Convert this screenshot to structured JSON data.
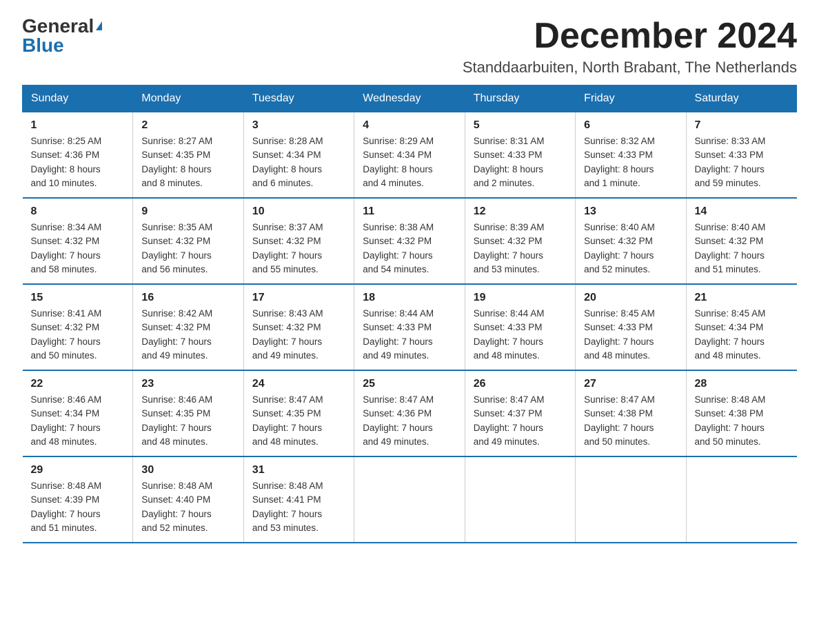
{
  "header": {
    "logo_general": "General",
    "logo_triangle": "▶",
    "logo_blue": "Blue",
    "month_title": "December 2024",
    "subtitle": "Standdaarbuiten, North Brabant, The Netherlands"
  },
  "weekdays": [
    "Sunday",
    "Monday",
    "Tuesday",
    "Wednesday",
    "Thursday",
    "Friday",
    "Saturday"
  ],
  "weeks": [
    [
      {
        "day": "1",
        "sunrise": "8:25 AM",
        "sunset": "4:36 PM",
        "daylight": "8 hours and 10 minutes."
      },
      {
        "day": "2",
        "sunrise": "8:27 AM",
        "sunset": "4:35 PM",
        "daylight": "8 hours and 8 minutes."
      },
      {
        "day": "3",
        "sunrise": "8:28 AM",
        "sunset": "4:34 PM",
        "daylight": "8 hours and 6 minutes."
      },
      {
        "day": "4",
        "sunrise": "8:29 AM",
        "sunset": "4:34 PM",
        "daylight": "8 hours and 4 minutes."
      },
      {
        "day": "5",
        "sunrise": "8:31 AM",
        "sunset": "4:33 PM",
        "daylight": "8 hours and 2 minutes."
      },
      {
        "day": "6",
        "sunrise": "8:32 AM",
        "sunset": "4:33 PM",
        "daylight": "8 hours and 1 minute."
      },
      {
        "day": "7",
        "sunrise": "8:33 AM",
        "sunset": "4:33 PM",
        "daylight": "7 hours and 59 minutes."
      }
    ],
    [
      {
        "day": "8",
        "sunrise": "8:34 AM",
        "sunset": "4:32 PM",
        "daylight": "7 hours and 58 minutes."
      },
      {
        "day": "9",
        "sunrise": "8:35 AM",
        "sunset": "4:32 PM",
        "daylight": "7 hours and 56 minutes."
      },
      {
        "day": "10",
        "sunrise": "8:37 AM",
        "sunset": "4:32 PM",
        "daylight": "7 hours and 55 minutes."
      },
      {
        "day": "11",
        "sunrise": "8:38 AM",
        "sunset": "4:32 PM",
        "daylight": "7 hours and 54 minutes."
      },
      {
        "day": "12",
        "sunrise": "8:39 AM",
        "sunset": "4:32 PM",
        "daylight": "7 hours and 53 minutes."
      },
      {
        "day": "13",
        "sunrise": "8:40 AM",
        "sunset": "4:32 PM",
        "daylight": "7 hours and 52 minutes."
      },
      {
        "day": "14",
        "sunrise": "8:40 AM",
        "sunset": "4:32 PM",
        "daylight": "7 hours and 51 minutes."
      }
    ],
    [
      {
        "day": "15",
        "sunrise": "8:41 AM",
        "sunset": "4:32 PM",
        "daylight": "7 hours and 50 minutes."
      },
      {
        "day": "16",
        "sunrise": "8:42 AM",
        "sunset": "4:32 PM",
        "daylight": "7 hours and 49 minutes."
      },
      {
        "day": "17",
        "sunrise": "8:43 AM",
        "sunset": "4:32 PM",
        "daylight": "7 hours and 49 minutes."
      },
      {
        "day": "18",
        "sunrise": "8:44 AM",
        "sunset": "4:33 PM",
        "daylight": "7 hours and 49 minutes."
      },
      {
        "day": "19",
        "sunrise": "8:44 AM",
        "sunset": "4:33 PM",
        "daylight": "7 hours and 48 minutes."
      },
      {
        "day": "20",
        "sunrise": "8:45 AM",
        "sunset": "4:33 PM",
        "daylight": "7 hours and 48 minutes."
      },
      {
        "day": "21",
        "sunrise": "8:45 AM",
        "sunset": "4:34 PM",
        "daylight": "7 hours and 48 minutes."
      }
    ],
    [
      {
        "day": "22",
        "sunrise": "8:46 AM",
        "sunset": "4:34 PM",
        "daylight": "7 hours and 48 minutes."
      },
      {
        "day": "23",
        "sunrise": "8:46 AM",
        "sunset": "4:35 PM",
        "daylight": "7 hours and 48 minutes."
      },
      {
        "day": "24",
        "sunrise": "8:47 AM",
        "sunset": "4:35 PM",
        "daylight": "7 hours and 48 minutes."
      },
      {
        "day": "25",
        "sunrise": "8:47 AM",
        "sunset": "4:36 PM",
        "daylight": "7 hours and 49 minutes."
      },
      {
        "day": "26",
        "sunrise": "8:47 AM",
        "sunset": "4:37 PM",
        "daylight": "7 hours and 49 minutes."
      },
      {
        "day": "27",
        "sunrise": "8:47 AM",
        "sunset": "4:38 PM",
        "daylight": "7 hours and 50 minutes."
      },
      {
        "day": "28",
        "sunrise": "8:48 AM",
        "sunset": "4:38 PM",
        "daylight": "7 hours and 50 minutes."
      }
    ],
    [
      {
        "day": "29",
        "sunrise": "8:48 AM",
        "sunset": "4:39 PM",
        "daylight": "7 hours and 51 minutes."
      },
      {
        "day": "30",
        "sunrise": "8:48 AM",
        "sunset": "4:40 PM",
        "daylight": "7 hours and 52 minutes."
      },
      {
        "day": "31",
        "sunrise": "8:48 AM",
        "sunset": "4:41 PM",
        "daylight": "7 hours and 53 minutes."
      },
      null,
      null,
      null,
      null
    ]
  ],
  "labels": {
    "sunrise": "Sunrise:",
    "sunset": "Sunset:",
    "daylight": "Daylight:"
  }
}
